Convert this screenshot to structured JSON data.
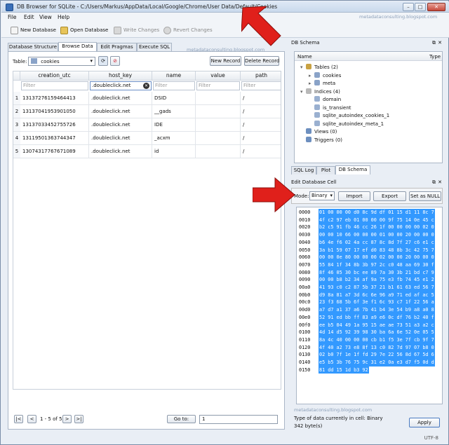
{
  "window": {
    "title": "DB Browser for SQLite - C:/Users/Markus/AppData/Local/Google/Chrome/User Data/Default/Cookies",
    "minimize": "–",
    "maximize": "□",
    "close": "✕",
    "watermark_top": "metadataconsulting.blogspot.com"
  },
  "menu": [
    "File",
    "Edit",
    "View",
    "Help"
  ],
  "toolbar": {
    "new_db": "New Database",
    "open_db": "Open Database",
    "write": "Write Changes",
    "revert": "Revert Changes"
  },
  "tabs": [
    "Database Structure",
    "Browse Data",
    "Edit Pragmas",
    "Execute SQL"
  ],
  "browse": {
    "watermark": "metadataconsulting.blogspot.com",
    "table_label": "Table:",
    "table_value": "cookies",
    "new_record": "New Record",
    "delete_record": "Delete Record",
    "columns": [
      "creation_utc",
      "host_key",
      "name",
      "value",
      "path"
    ],
    "filters": [
      "Filter",
      ".doubleclick.net",
      "Filter",
      "Filter",
      "Filter"
    ],
    "rows": [
      {
        "n": "1",
        "creation_utc": "13137276159464413",
        "host_key": ".doubleclick.net",
        "name": "DSID",
        "value": "",
        "path": "/"
      },
      {
        "n": "2",
        "creation_utc": "13137041953901050",
        "host_key": ".doubleclick.net",
        "name": "__gads",
        "value": "",
        "path": "/"
      },
      {
        "n": "3",
        "creation_utc": "13137033452755726",
        "host_key": ".doubleclick.net",
        "name": "IDE",
        "value": "",
        "path": "/"
      },
      {
        "n": "4",
        "creation_utc": "13119501363744347",
        "host_key": ".doubleclick.net",
        "name": "_acxm",
        "value": "",
        "path": "/"
      },
      {
        "n": "5",
        "creation_utc": "13074317767671089",
        "host_key": ".doubleclick.net",
        "name": "id",
        "value": "",
        "path": "/"
      }
    ],
    "nav": {
      "first": "|<",
      "prev": "<",
      "range": "1 - 5 of 5",
      "next": ">",
      "last": ">|",
      "goto": "Go to:",
      "goto_value": "1"
    }
  },
  "schema": {
    "title": "DB Schema",
    "col_name": "Name",
    "col_type": "Type",
    "tree": [
      {
        "label": "Tables (2)",
        "level": 0,
        "exp": "▾",
        "color": "#c9a243"
      },
      {
        "label": "cookies",
        "level": 2,
        "exp": "▸",
        "color": "#8aa3c8"
      },
      {
        "label": "meta",
        "level": 2,
        "exp": "▸",
        "color": "#8aa3c8"
      },
      {
        "label": "Indices (4)",
        "level": 0,
        "exp": "▾",
        "color": "#b8b8b8"
      },
      {
        "label": "domain",
        "level": 2,
        "exp": "",
        "color": "#9ab0d0"
      },
      {
        "label": "is_transient",
        "level": 2,
        "exp": "",
        "color": "#9ab0d0"
      },
      {
        "label": "sqlite_autoindex_cookies_1",
        "level": 2,
        "exp": "",
        "color": "#9ab0d0"
      },
      {
        "label": "sqlite_autoindex_meta_1",
        "level": 2,
        "exp": "",
        "color": "#9ab0d0"
      },
      {
        "label": "Views (0)",
        "level": 0,
        "exp": "",
        "color": "#6d8fbf"
      },
      {
        "label": "Triggers (0)",
        "level": 0,
        "exp": "",
        "color": "#6d8fbf"
      }
    ],
    "tabs": [
      "SQL Log",
      "Plot",
      "DB Schema"
    ]
  },
  "editcell": {
    "title": "Edit Database Cell",
    "mode_label": "Mode:",
    "mode_value": "Binary",
    "import": "Import",
    "export": "Export",
    "set_null": "Set as NULL",
    "hex": [
      {
        "off": "0000",
        "hex": "01 00 00 00 d0 8c 9d df 01 15 d1 11 8c 7"
      },
      {
        "off": "0010",
        "hex": "4f c2 97 eb 01 00 00 00 9f 75 14 0e 45 c"
      },
      {
        "off": "0020",
        "hex": "b2 c5 91 fb 46 cc 26 1f 00 00 00 00 02 0"
      },
      {
        "off": "0030",
        "hex": "00 00 10 66 00 00 00 01 00 00 20 00 00 0"
      },
      {
        "off": "0040",
        "hex": "b6 4e f6 02 4a cc 87 8c 8d 7f 27 c6 e1 c"
      },
      {
        "off": "0050",
        "hex": "3a b1 59 07 17 ef d0 83 48 8b 3c 42 75 7"
      },
      {
        "off": "0060",
        "hex": "00 00 0e 80 00 00 00 02 00 00 20 00 00 0"
      },
      {
        "off": "0070",
        "hex": "55 84 1f 34 8b 3b 97 2c c0 48 aa 69 30 f"
      },
      {
        "off": "0080",
        "hex": "8f 46 05 30 bc ee 89 7a 30 3b 21 bd c7 9"
      },
      {
        "off": "0090",
        "hex": "00 00 b8 b2 34 af 9a 75 e3 fb 74 45 e1 2"
      },
      {
        "off": "00a0",
        "hex": "41 93 c0 c2 87 5b 37 21 b1 61 63 ed 56 7"
      },
      {
        "off": "00b0",
        "hex": "d9 8a 81 a7 3d 6c 6e 96 a9 71 ed af ac 5"
      },
      {
        "off": "00c0",
        "hex": "23 f3 68 5b 6f 3e f1 6c 93 c7 1f 22 56 a"
      },
      {
        "off": "00d0",
        "hex": "a7 d7 a1 37 a6 7b 41 b4 3e 54 b9 a8 a0 8"
      },
      {
        "off": "00e0",
        "hex": "52 91 ed bb ff 83 a9 e6 0c df 76 b2 40 f"
      },
      {
        "off": "00f0",
        "hex": "ee b5 04 49 1a 95 15 ae ae 73 51 a3 a2 c"
      },
      {
        "off": "0100",
        "hex": "4d 14 d5 92 39 98 30 ba 6a 6e 52 0e 05 5"
      },
      {
        "off": "0110",
        "hex": "8a 4c 40 00 00 00 cb b1 f5 3e 7f cb 9f 7"
      },
      {
        "off": "0120",
        "hex": "4f 40 a2 73 e8 8f 13 c0 82 7d 97 07 b8 0"
      },
      {
        "off": "0130",
        "hex": "02 b0 7f 1e 1f fd 29 7e 22 56 8d 67 5d 6"
      },
      {
        "off": "0140",
        "hex": "e5 b5 3b 76 75 9c 31 e2 0a e3 d7 f5 0d d"
      },
      {
        "off": "0150",
        "hex": "81 dd 15 1d b3 92"
      }
    ],
    "watermark": "metadataconsulting.blogspot.com",
    "type_info": "Type of data currently in cell: Binary",
    "size_info": "342 byte(s)",
    "apply": "Apply"
  },
  "status": {
    "encoding": "UTF-8"
  },
  "colors": {
    "selection": "#3399ff",
    "arrow": "#e0201b",
    "chrome": "#e9eef5"
  }
}
